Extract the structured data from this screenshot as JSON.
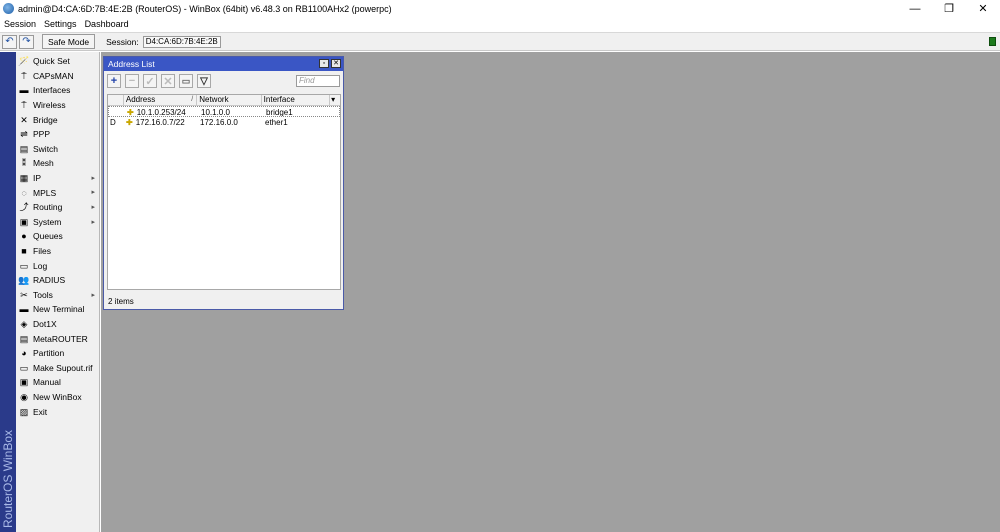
{
  "window": {
    "title": "admin@D4:CA:6D:7B:4E:2B (RouterOS) - WinBox (64bit) v6.48.3 on RB1100AHx2 (powerpc)",
    "controls": {
      "minimize": "—",
      "restore": "❐",
      "close": "✕"
    }
  },
  "menubar": [
    "Session",
    "Settings",
    "Dashboard"
  ],
  "toolbar": {
    "undo": "↶",
    "redo": "↷",
    "safe_mode": "Safe Mode",
    "session_label": "Session:",
    "session_value": "D4:CA:6D:7B:4E:2B"
  },
  "banner": "RouterOS WinBox",
  "sidebar": [
    {
      "label": "Quick Set",
      "icon": "wand-icon",
      "glyph": "🪄",
      "sub": false
    },
    {
      "label": "CAPsMAN",
      "icon": "antenna-icon",
      "glyph": "⍑",
      "sub": false
    },
    {
      "label": "Interfaces",
      "icon": "interfaces-icon",
      "glyph": "▬",
      "sub": false
    },
    {
      "label": "Wireless",
      "icon": "wireless-icon",
      "glyph": "⍑",
      "sub": false
    },
    {
      "label": "Bridge",
      "icon": "bridge-icon",
      "glyph": "✕",
      "sub": false
    },
    {
      "label": "PPP",
      "icon": "ppp-icon",
      "glyph": "⇌",
      "sub": false
    },
    {
      "label": "Switch",
      "icon": "switch-icon",
      "glyph": "▤",
      "sub": false
    },
    {
      "label": "Mesh",
      "icon": "mesh-icon",
      "glyph": "⁑",
      "sub": false
    },
    {
      "label": "IP",
      "icon": "ip-icon",
      "glyph": "▦",
      "sub": true
    },
    {
      "label": "MPLS",
      "icon": "mpls-icon",
      "glyph": "◌",
      "sub": true
    },
    {
      "label": "Routing",
      "icon": "routing-icon",
      "glyph": "⤴",
      "sub": true
    },
    {
      "label": "System",
      "icon": "system-icon",
      "glyph": "▣",
      "sub": true
    },
    {
      "label": "Queues",
      "icon": "queues-icon",
      "glyph": "●",
      "sub": false
    },
    {
      "label": "Files",
      "icon": "folder-icon",
      "glyph": "■",
      "sub": false
    },
    {
      "label": "Log",
      "icon": "log-icon",
      "glyph": "▭",
      "sub": false
    },
    {
      "label": "RADIUS",
      "icon": "radius-icon",
      "glyph": "👥",
      "sub": false
    },
    {
      "label": "Tools",
      "icon": "tools-icon",
      "glyph": "✂",
      "sub": true
    },
    {
      "label": "New Terminal",
      "icon": "terminal-icon",
      "glyph": "▬",
      "sub": false
    },
    {
      "label": "Dot1X",
      "icon": "dot1x-icon",
      "glyph": "◈",
      "sub": false
    },
    {
      "label": "MetaROUTER",
      "icon": "metarouter-icon",
      "glyph": "▤",
      "sub": false
    },
    {
      "label": "Partition",
      "icon": "partition-icon",
      "glyph": "◕",
      "sub": false
    },
    {
      "label": "Make Supout.rif",
      "icon": "supout-icon",
      "glyph": "▭",
      "sub": false
    },
    {
      "label": "Manual",
      "icon": "manual-icon",
      "glyph": "▣",
      "sub": false
    },
    {
      "label": "New WinBox",
      "icon": "winbox-icon",
      "glyph": "◉",
      "sub": false
    },
    {
      "label": "Exit",
      "icon": "exit-icon",
      "glyph": "▨",
      "sub": false
    }
  ],
  "address_list": {
    "title": "Address List",
    "find_placeholder": "Find",
    "columns": [
      "",
      "Address",
      "Network",
      "Interface"
    ],
    "rows": [
      {
        "flag": "",
        "address": "10.1.0.253/24",
        "network": "10.1.0.0",
        "interface": "bridge1"
      },
      {
        "flag": "D",
        "address": "172.16.0.7/22",
        "network": "172.16.0.0",
        "interface": "ether1"
      }
    ],
    "status": "2 items"
  },
  "colors": {
    "title_blue": "#3a56c5",
    "banner_blue": "#2a3a8a",
    "workarea_gray": "#a0a0a0"
  }
}
